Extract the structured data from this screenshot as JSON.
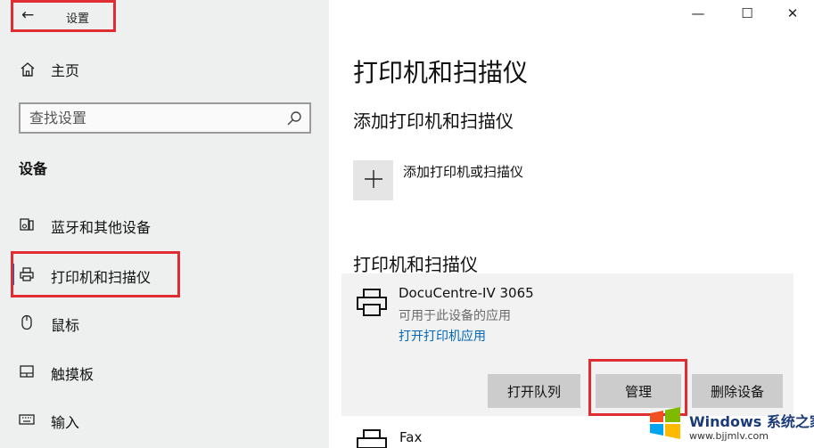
{
  "window": {
    "title": "设置",
    "back_icon": "back-arrow-icon",
    "controls": [
      "minimize-icon",
      "maximize-icon",
      "close-icon"
    ]
  },
  "sidebar": {
    "home_label": "主页",
    "search_placeholder": "查找设置",
    "section_label": "设备",
    "items": [
      {
        "label": "蓝牙和其他设备",
        "icon": "bluetooth-device-icon",
        "active": false
      },
      {
        "label": "打印机和扫描仪",
        "icon": "printer-icon",
        "active": true
      },
      {
        "label": "鼠标",
        "icon": "mouse-icon",
        "active": false
      },
      {
        "label": "触摸板",
        "icon": "touchpad-icon",
        "active": false
      },
      {
        "label": "输入",
        "icon": "keyboard-icon",
        "active": false
      }
    ]
  },
  "main": {
    "page_title": "打印机和扫描仪",
    "add_section_title": "添加打印机和扫描仪",
    "add_button_label": "添加打印机或扫描仪",
    "list_section_title": "打印机和扫描仪",
    "printers": [
      {
        "name": "DocuCentre-IV 3065",
        "subtitle": "可用于此设备的应用",
        "link": "打开打印机应用",
        "buttons": {
          "open_queue": "打开队列",
          "manage": "管理",
          "remove": "删除设备"
        }
      },
      {
        "name": "Fax"
      }
    ]
  },
  "watermark": {
    "brand": "Windows",
    "site_name": "系统之家",
    "url": "www.bjjmlv.com"
  },
  "colors": {
    "accent": "#0067c0",
    "link": "#0067b8",
    "highlight_box": "#e02d34",
    "sidebar_bg": "#eef0ef"
  }
}
